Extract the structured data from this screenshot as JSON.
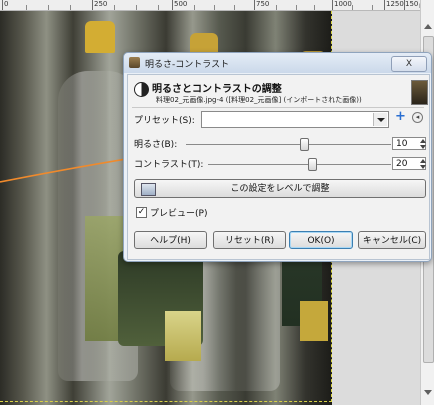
{
  "ruler": {
    "labels": [
      "0",
      "250",
      "500",
      "750",
      "1000",
      "1250",
      "150"
    ]
  },
  "canvas_window": {
    "corner_button": "⊠"
  },
  "dialog": {
    "window_title": "明るさ-コントラスト",
    "close_label": "X",
    "header_title": "明るさとコントラストの調整",
    "header_subtitle": "料理02_元画像.jpg-4 ([料理02_元画像] (インポートされた画像))",
    "preset_label": "プリセット(S):",
    "preset_value": "",
    "brightness_label": "明るさ(B):",
    "brightness_value": "10",
    "contrast_label": "コントラスト(T):",
    "contrast_value": "20",
    "levels_button": "この設定をレベルで調整",
    "preview_label": "プレビュー(P)",
    "preview_checked": "✓",
    "help_button": "ヘルプ(H)",
    "reset_button": "リセット(R)",
    "ok_button": "OK(O)",
    "cancel_button": "キャンセル(C)"
  },
  "colors": {
    "accent_arrow": "#f08a2c",
    "selection_border": "#d8d246"
  }
}
